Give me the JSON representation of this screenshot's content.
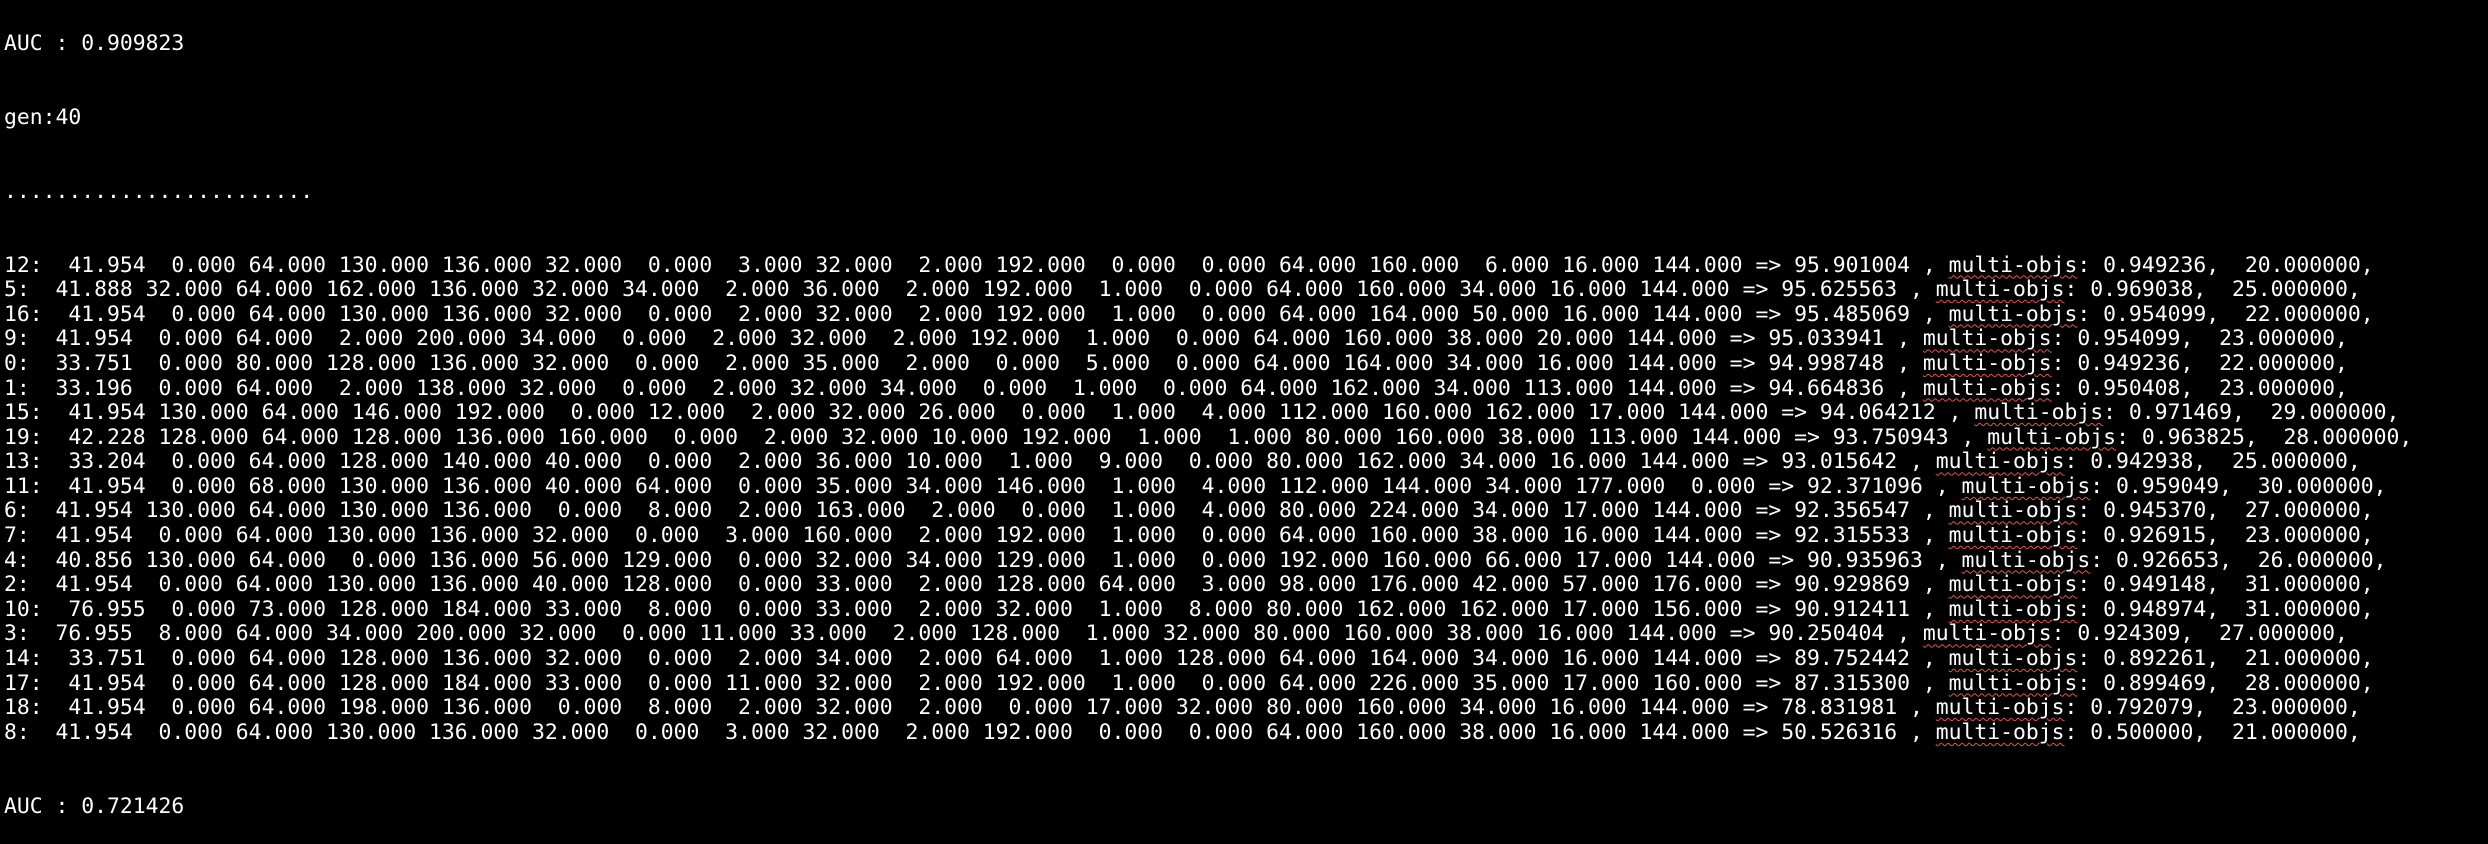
{
  "terminal": {
    "prev_auc_line": "AUC : 0.909823",
    "generation_line": "gen:40",
    "progress_dots": "........................",
    "rows": [
      {
        "pre": "12:  41.954  0.000 64.000 130.000 136.000 32.000  0.000  3.000 32.000  2.000 192.000  0.000  0.000 64.000 160.000  6.000 16.000 144.000 => 95.901004 , ",
        "tag": "multi-objs",
        "post": ": 0.949236,  20.000000,"
      },
      {
        "pre": "5:  41.888 32.000 64.000 162.000 136.000 32.000 34.000  2.000 36.000  2.000 192.000  1.000  0.000 64.000 160.000 34.000 16.000 144.000 => 95.625563 , ",
        "tag": "multi-objs",
        "post": ": 0.969038,  25.000000,"
      },
      {
        "pre": "16:  41.954  0.000 64.000 130.000 136.000 32.000  0.000  2.000 32.000  2.000 192.000  1.000  0.000 64.000 164.000 50.000 16.000 144.000 => 95.485069 , ",
        "tag": "multi-objs",
        "post": ": 0.954099,  22.000000,"
      },
      {
        "pre": "9:  41.954  0.000 64.000  2.000 200.000 34.000  0.000  2.000 32.000  2.000 192.000  1.000  0.000 64.000 160.000 38.000 20.000 144.000 => 95.033941 , ",
        "tag": "multi-objs",
        "post": ": 0.954099,  23.000000,"
      },
      {
        "pre": "0:  33.751  0.000 80.000 128.000 136.000 32.000  0.000  2.000 35.000  2.000  0.000  5.000  0.000 64.000 164.000 34.000 16.000 144.000 => 94.998748 , ",
        "tag": "multi-objs",
        "post": ": 0.949236,  22.000000,"
      },
      {
        "pre": "1:  33.196  0.000 64.000  2.000 138.000 32.000  0.000  2.000 32.000 34.000  0.000  1.000  0.000 64.000 162.000 34.000 113.000 144.000 => 94.664836 , ",
        "tag": "multi-objs",
        "post": ": 0.950408,  23.000000,"
      },
      {
        "pre": "15:  41.954 130.000 64.000 146.000 192.000  0.000 12.000  2.000 32.000 26.000  0.000  1.000  4.000 112.000 160.000 162.000 17.000 144.000 => 94.064212 , ",
        "tag": "multi-objs",
        "post": ": 0.971469,  29.000000,"
      },
      {
        "pre": "19:  42.228 128.000 64.000 128.000 136.000 160.000  0.000  2.000 32.000 10.000 192.000  1.000  1.000 80.000 160.000 38.000 113.000 144.000 => 93.750943 , ",
        "tag": "multi-objs",
        "post": ": 0.963825,  28.000000,"
      },
      {
        "pre": "13:  33.204  0.000 64.000 128.000 140.000 40.000  0.000  2.000 36.000 10.000  1.000  9.000  0.000 80.000 162.000 34.000 16.000 144.000 => 93.015642 , ",
        "tag": "multi-objs",
        "post": ": 0.942938,  25.000000,"
      },
      {
        "pre": "11:  41.954  0.000 68.000 130.000 136.000 40.000 64.000  0.000 35.000 34.000 146.000  1.000  4.000 112.000 144.000 34.000 177.000  0.000 => 92.371096 , ",
        "tag": "multi-objs",
        "post": ": 0.959049,  30.000000,"
      },
      {
        "pre": "6:  41.954 130.000 64.000 130.000 136.000  0.000  8.000  2.000 163.000  2.000  0.000  1.000  4.000 80.000 224.000 34.000 17.000 144.000 => 92.356547 , ",
        "tag": "multi-objs",
        "post": ": 0.945370,  27.000000,"
      },
      {
        "pre": "7:  41.954  0.000 64.000 130.000 136.000 32.000  0.000  3.000 160.000  2.000 192.000  1.000  0.000 64.000 160.000 38.000 16.000 144.000 => 92.315533 , ",
        "tag": "multi-objs",
        "post": ": 0.926915,  23.000000,"
      },
      {
        "pre": "4:  40.856 130.000 64.000  0.000 136.000 56.000 129.000  0.000 32.000 34.000 129.000  1.000  0.000 192.000 160.000 66.000 17.000 144.000 => 90.935963 , ",
        "tag": "multi-objs",
        "post": ": 0.926653,  26.000000,"
      },
      {
        "pre": "2:  41.954  0.000 64.000 130.000 136.000 40.000 128.000  0.000 33.000  2.000 128.000 64.000  3.000 98.000 176.000 42.000 57.000 176.000 => 90.929869 , ",
        "tag": "multi-objs",
        "post": ": 0.949148,  31.000000,"
      },
      {
        "pre": "10:  76.955  0.000 73.000 128.000 184.000 33.000  8.000  0.000 33.000  2.000 32.000  1.000  8.000 80.000 162.000 162.000 17.000 156.000 => 90.912411 , ",
        "tag": "multi-objs",
        "post": ": 0.948974,  31.000000,"
      },
      {
        "pre": "3:  76.955  8.000 64.000 34.000 200.000 32.000  0.000 11.000 33.000  2.000 128.000  1.000 32.000 80.000 160.000 38.000 16.000 144.000 => 90.250404 , ",
        "tag": "multi-objs",
        "post": ": 0.924309,  27.000000,"
      },
      {
        "pre": "14:  33.751  0.000 64.000 128.000 136.000 32.000  0.000  2.000 34.000  2.000 64.000  1.000 128.000 64.000 164.000 34.000 16.000 144.000 => 89.752442 , ",
        "tag": "multi-objs",
        "post": ": 0.892261,  21.000000,"
      },
      {
        "pre": "17:  41.954  0.000 64.000 128.000 184.000 33.000  0.000 11.000 32.000  2.000 192.000  1.000  0.000 64.000 226.000 35.000 17.000 160.000 => 87.315300 , ",
        "tag": "multi-objs",
        "post": ": 0.899469,  28.000000,"
      },
      {
        "pre": "18:  41.954  0.000 64.000 198.000 136.000  0.000  8.000  2.000 32.000  2.000  0.000 17.000 32.000 80.000 160.000 34.000 16.000 144.000 => 78.831981 , ",
        "tag": "multi-objs",
        "post": ": 0.792079,  23.000000,"
      },
      {
        "pre": "8:  41.954  0.000 64.000 130.000 136.000 32.000  0.000  3.000 32.000  2.000 192.000  0.000  0.000 64.000 160.000 38.000 16.000 144.000 => 50.526316 , ",
        "tag": "multi-objs",
        "post": ": 0.500000,  21.000000,"
      }
    ],
    "auc_line": "AUC : 0.721426"
  },
  "colors": {
    "background": "#000000",
    "text": "#ffffff",
    "spellcheck_underline": "#e0554f"
  }
}
